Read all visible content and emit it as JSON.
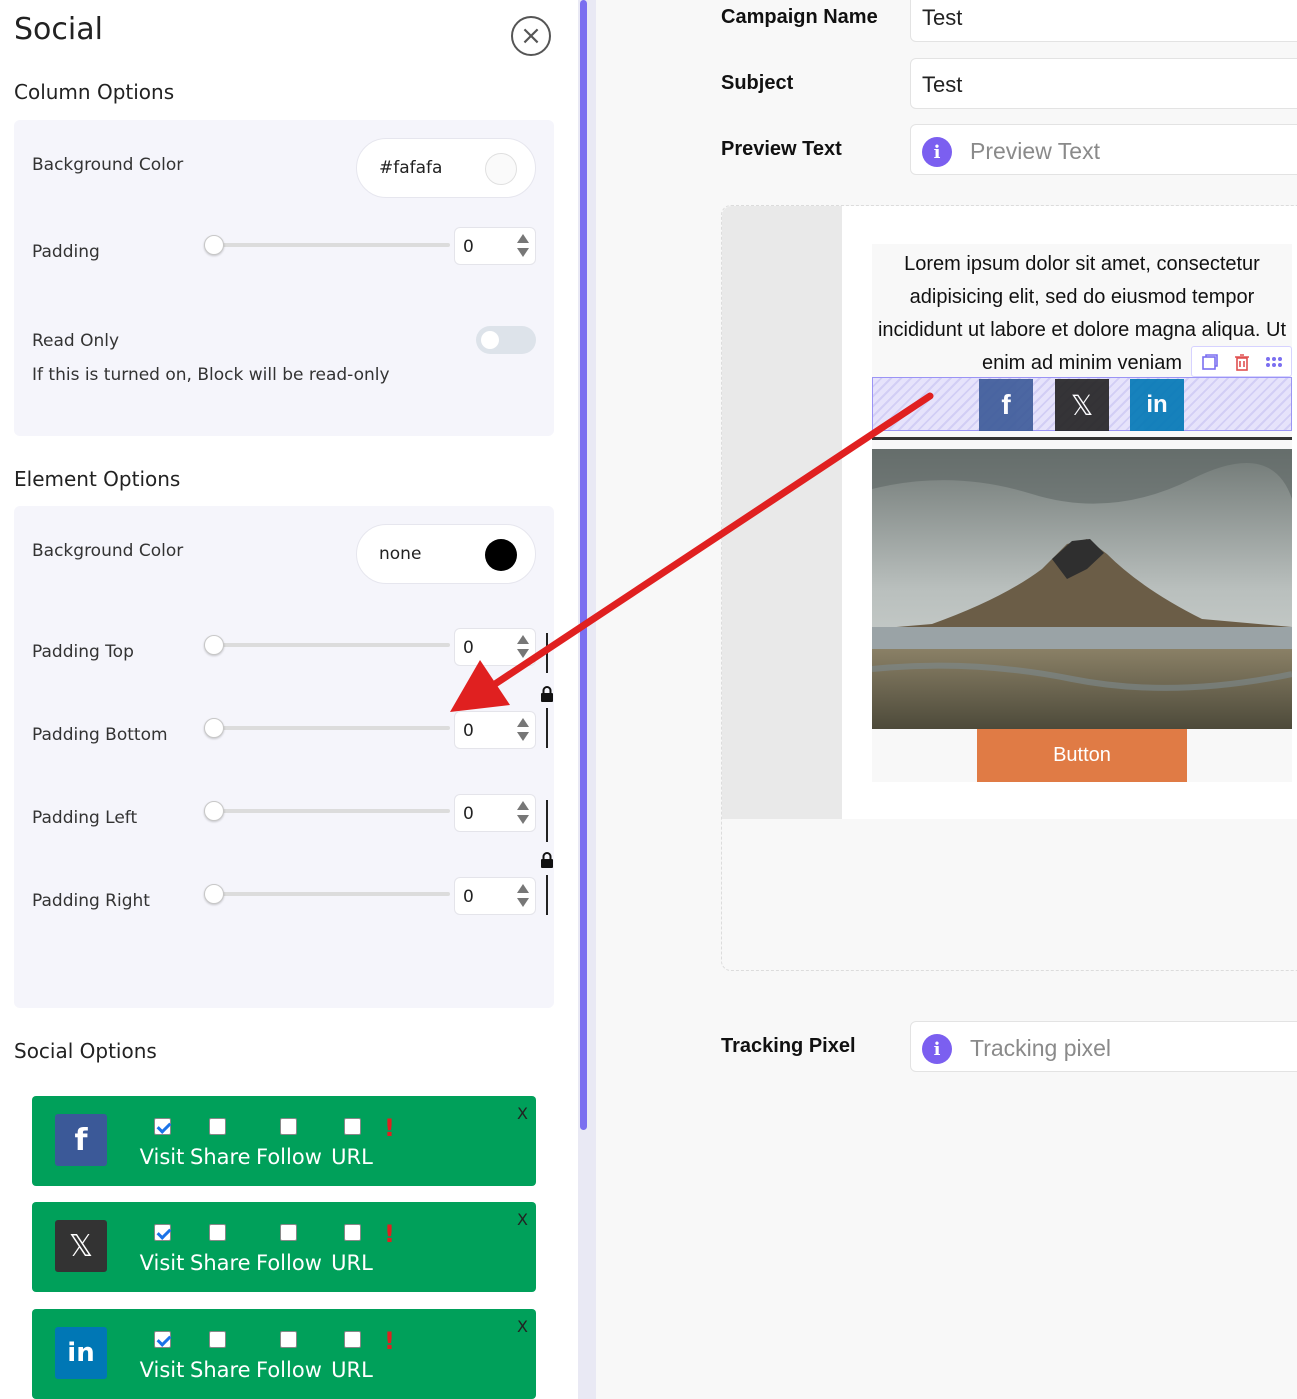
{
  "panel": {
    "title": "Social",
    "column_options": {
      "heading": "Column Options",
      "background_color_label": "Background Color",
      "background_color_value": "#fafafa",
      "background_swatch": "#fafafa",
      "padding_label": "Padding",
      "padding_value": "0",
      "read_only_label": "Read Only",
      "read_only_help": "If this is turned on, Block will be read-only",
      "read_only_on": false
    },
    "element_options": {
      "heading": "Element Options",
      "background_color_label": "Background Color",
      "background_color_value": "none",
      "background_swatch": "#000000",
      "padding_top_label": "Padding Top",
      "padding_top_value": "0",
      "padding_bottom_label": "Padding Bottom",
      "padding_bottom_value": "0",
      "padding_left_label": "Padding Left",
      "padding_left_value": "0",
      "padding_right_label": "Padding Right",
      "padding_right_value": "0"
    },
    "social_options": {
      "heading": "Social Options",
      "option_labels": [
        "Visit",
        "Share",
        "Follow",
        "URL"
      ],
      "remove_label": "X",
      "warning_glyph": "!",
      "rows": [
        {
          "network": "facebook",
          "icon": "facebook-icon",
          "glyph": "f",
          "color": "#3b5998",
          "checked": [
            true,
            false,
            false,
            false
          ]
        },
        {
          "network": "x",
          "icon": "x-icon",
          "glyph": "𝕏",
          "color": "#333333",
          "checked": [
            true,
            false,
            false,
            false
          ]
        },
        {
          "network": "linkedin",
          "icon": "linkedin-icon",
          "glyph": "in",
          "color": "#0077b5",
          "checked": [
            true,
            false,
            false,
            false
          ]
        }
      ]
    }
  },
  "form": {
    "campaign_name_label": "Campaign Name",
    "campaign_name_value": "Test",
    "subject_label": "Subject",
    "subject_value": "Test",
    "preview_text_label": "Preview Text",
    "preview_text_placeholder": "Preview Text",
    "tracking_pixel_label": "Tracking Pixel",
    "tracking_pixel_placeholder": "Tracking pixel",
    "info_glyph": "i"
  },
  "preview": {
    "lorem": "Lorem ipsum dolor sit amet, consectetur adipisicing elit, sed do eiusmod tempor incididunt ut labore et dolore magna aliqua. Ut enim ad minim veniam",
    "social_icons": [
      {
        "icon": "facebook-icon",
        "glyph": "f",
        "color": "#3b5998"
      },
      {
        "icon": "x-icon",
        "glyph": "𝕏",
        "color": "#222222"
      },
      {
        "icon": "linkedin-icon",
        "glyph": "in",
        "color": "#0077b5"
      }
    ],
    "button_label": "Button"
  },
  "colors": {
    "accent": "#7b6ff0",
    "social_row_bg": "#00a05a",
    "button": "#e07b45",
    "arrow": "#e02020"
  }
}
